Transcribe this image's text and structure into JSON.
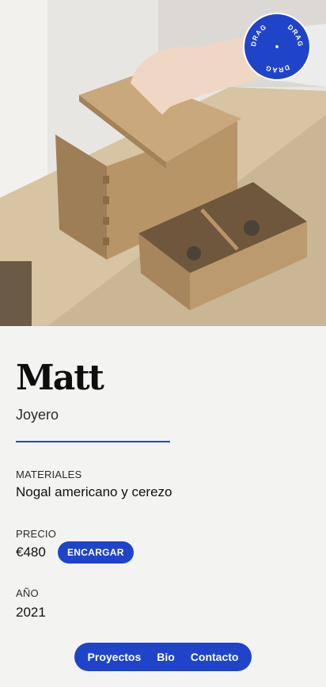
{
  "hero": {
    "badge_text": "DRAG"
  },
  "product": {
    "title": "Matt",
    "subtitle": "Joyero",
    "materials_label": "MATERIALES",
    "materials_value": "Nogal americano y cerezo",
    "price_label": "PRECIO",
    "price_value": "€480",
    "order_label": "ENCARGAR",
    "year_label": "AÑO",
    "year_value": "2021"
  },
  "nav": {
    "items": [
      "Proyectos",
      "Bio",
      "Contacto"
    ]
  },
  "colors": {
    "accent": "#1f44c9",
    "background": "#f3f3f1"
  }
}
